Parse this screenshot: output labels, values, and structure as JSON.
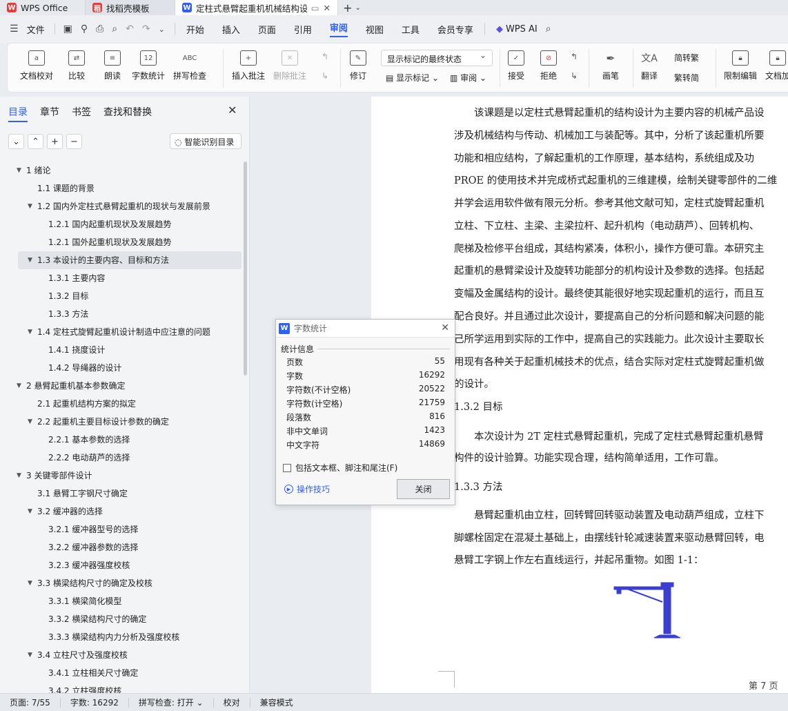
{
  "tabs": [
    {
      "label": "WPS Office"
    },
    {
      "label": "找稻壳模板"
    },
    {
      "label": "定柱式悬臂起重机机械结构设"
    }
  ],
  "menubar": {
    "file": "文件",
    "items": [
      "开始",
      "插入",
      "页面",
      "引用",
      "审阅",
      "视图",
      "工具",
      "会员专享"
    ],
    "active": "审阅",
    "ai": "WPS AI"
  },
  "ribbon": {
    "proofread": "文档校对",
    "compare": "比较",
    "read_aloud": "朗读",
    "word_count": "字数统计",
    "spell_check": "拼写检查",
    "insert_comment": "插入批注",
    "delete_comment": "删除批注",
    "track_changes": "修订",
    "markup_select": "显示标记的最终状态",
    "show_markup": "显示标记",
    "review": "审阅",
    "accept": "接受",
    "reject": "拒绝",
    "pen": "画笔",
    "translate": "翻译",
    "to_traditional": "简转繁",
    "to_simplified": "繁转简",
    "restrict_edit": "限制编辑",
    "doc_encrypt": "文档加"
  },
  "nav": {
    "tabs": [
      "目录",
      "章节",
      "书签",
      "查找和替换"
    ],
    "active_tab": "目录",
    "ai_toc": "智能识别目录",
    "toc": [
      {
        "label": "1   绪论",
        "level": 1
      },
      {
        "label": "1.1  课题的背景",
        "level": 2
      },
      {
        "label": "1.2 国内外定柱式悬臂起重机的现状与发展前景",
        "level": 2
      },
      {
        "label": "1.2.1  国内起重机现状及发展趋势",
        "level": 3
      },
      {
        "label": "1.2.1  国外起重机现状及发展趋势",
        "level": 3
      },
      {
        "label": "1.3  本设计的主要内容、目标和方法",
        "level": 2
      },
      {
        "label": "1.3.1 主要内容",
        "level": 3
      },
      {
        "label": "1.3.2 目标",
        "level": 3
      },
      {
        "label": "1.3.3 方法",
        "level": 3
      },
      {
        "label": "1.4 定柱式旋臂起重机设计制造中应注意的问题",
        "level": 2
      },
      {
        "label": "1.4.1  挠度设计",
        "level": 3
      },
      {
        "label": "1.4.2  导绳器的设计",
        "level": 3
      },
      {
        "label": "2   悬臂起重机基本参数确定",
        "level": 1
      },
      {
        "label": "2.1 起重机结构方案的拟定",
        "level": 2
      },
      {
        "label": "2.2 起重机主要目标设计参数的确定",
        "level": 2
      },
      {
        "label": "2.2.1  基本参数的选择",
        "level": 3
      },
      {
        "label": "2.2.2  电动葫芦的选择",
        "level": 3
      },
      {
        "label": "3   关键零部件设计",
        "level": 1
      },
      {
        "label": "3.1 悬臂工字钢尺寸确定",
        "level": 2
      },
      {
        "label": "3.2 缓冲器的选择",
        "level": 2
      },
      {
        "label": "3.2.1 缓冲器型号的选择",
        "level": 3
      },
      {
        "label": "3.2.2 缓冲器参数的选择",
        "level": 3
      },
      {
        "label": "3.2.3 缓冲器强度校核",
        "level": 3
      },
      {
        "label": "3.3 横梁结构尺寸的确定及校核",
        "level": 2
      },
      {
        "label": "3.3.1 横梁简化模型",
        "level": 3
      },
      {
        "label": "3.3.2 横梁结构尺寸的确定",
        "level": 3
      },
      {
        "label": "3.3.3 横梁结构内力分析及强度校核",
        "level": 3
      },
      {
        "label": "3.4 立柱尺寸及强度校核",
        "level": 2
      },
      {
        "label": "3.4.1 立柱相关尺寸确定",
        "level": 3
      },
      {
        "label": "3.4.2 立柱强度校核",
        "level": 3
      }
    ]
  },
  "document": {
    "lines": [
      "　　该课题是以定柱式悬臂起重机的结构设计为主要内容的机械产品设",
      "涉及机械结构与传动、机械加工与装配等。其中，分析了该起重机所要",
      "功能和相应结构，了解起重机的工作原理，基本结构，系统组成及功",
      "PROE 的使用技术并完成桥式起重机的三维建模，绘制关键零部件的二维",
      "并学会运用软件做有限元分析。参考其他文献可知，定柱式旋臂起重机",
      "立柱、下立柱、主梁、主梁拉杆、起升机构（电动葫芦）、回转机构、",
      "爬梯及检修平台组成，其结构紧凑，体积小，操作方便可靠。本研究主",
      "起重机的悬臂梁设计及旋转功能部分的机构设计及参数的选择。包括起",
      "变幅及金属结构的设计。最终使其能很好地实现起重机的运行，而且互",
      "配合良好。并且通过此次设计，要提高自己的分析问题和解决问题的能",
      "己所学运用到实际的工作中，提高自己的实践能力。此次设计主要取长",
      "用现有各种关于起重机械技术的优点，结合实际对定柱式旋臂起重机做",
      "的设计。",
      "1.3.2 目标",
      "　　本次设计为 2T 定柱式悬臂起重机，完成了定柱式悬臂起重机悬臂",
      "构件的设计验算。功能实现合理，结构简单适用，工作可靠。",
      "1.3.3 方法",
      "　　悬臂起重机由立柱，回转臂回转驱动装置及电动葫芦组成，立柱下",
      "脚螺栓固定在混凝土基础上，由摆线针轮减速装置来驱动悬臂回转，电",
      "悬臂工字钢上作左右直线运行，并起吊重物。如图 1-1："
    ],
    "page_label": "第 7 页"
  },
  "dialog": {
    "title": "字数统计",
    "section": "统计信息",
    "stats": [
      {
        "label": "页数",
        "value": "55"
      },
      {
        "label": "字数",
        "value": "16292"
      },
      {
        "label": "字符数(不计空格)",
        "value": "20522"
      },
      {
        "label": "字符数(计空格)",
        "value": "21759"
      },
      {
        "label": "段落数",
        "value": "816"
      },
      {
        "label": "非中文单词",
        "value": "1423"
      },
      {
        "label": "中文字符",
        "value": "14869"
      }
    ],
    "checkbox_label": "包括文本框、脚注和尾注(F)",
    "tips": "操作技巧",
    "close_button": "关闭"
  },
  "statusbar": {
    "page": "页面: 7/55",
    "words": "字数: 16292",
    "spell": "拼写检查: 打开",
    "proof": "校对",
    "compat": "兼容模式"
  },
  "colors": {
    "accent": "#2f5ff3",
    "crane": "#3a3fd1"
  }
}
